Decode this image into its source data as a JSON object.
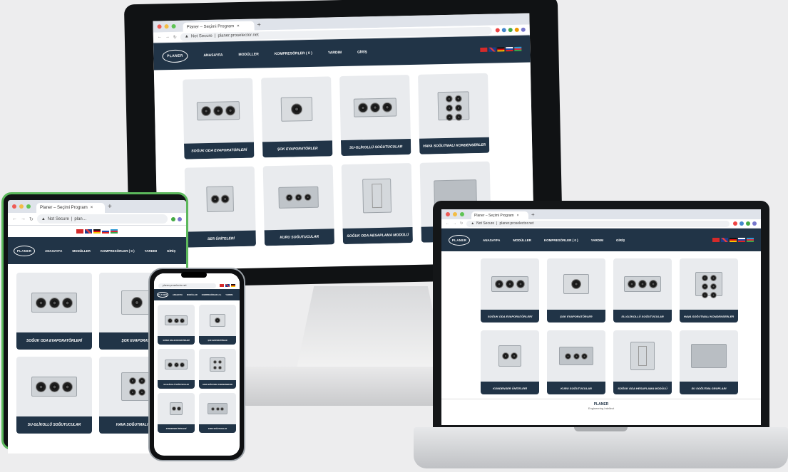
{
  "browser": {
    "tab_title": "Planer – Seçimi Program",
    "not_secure": "Not Secure",
    "url": "planer.proselector.net",
    "url_short": "plan…"
  },
  "site": {
    "logo": "PLANER",
    "nav": [
      "ANASAYFA",
      "MODÜLLER",
      "KOMPRESÖRLER ( 0 )",
      "YARDIM",
      "GİRİŞ"
    ],
    "cards": [
      "SOĞUK ODA EVAPORATÖRLERİ",
      "ŞOK EVAPORATÖRLER",
      "SU-GLİKOLLÜ SOĞUTUCULAR",
      "HAVA SOĞUTMALI KONDENSERLER",
      "KONDENSER ÜNİTELERİ",
      "KURU SOĞUTUCULAR",
      "SOĞUK ODA HESAPLAMA MODÜLÜ",
      "SU SOĞUTMA GRUPLARI"
    ],
    "footer_brand": "PLANER",
    "footer_tagline": "Engineering Intellect"
  },
  "tablet_labels": {
    "desktop_partial": "SER ÜNİTELERİ",
    "evap_partial": "ŞOK EVAPORATÖ",
    "su_grup_partial": "SU SOĞUTMA G",
    "kond_partial": "HAVA SOĞUTMALI KONI"
  },
  "colors": {
    "nav": "#213447",
    "card_bg": "#e9ebee",
    "tablet_frame": "#5cb85c"
  }
}
